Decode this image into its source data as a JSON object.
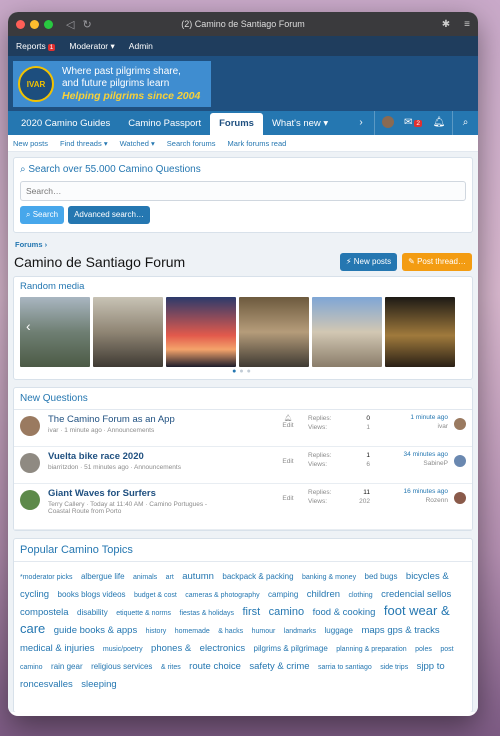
{
  "window": {
    "title": "(2) Camino de Santiago Forum"
  },
  "staffbar": {
    "reports": "Reports",
    "reports_count": "1",
    "moderator": "Moderator",
    "admin": "Admin"
  },
  "logo": {
    "mark": "IVAR",
    "line1": "Where past pilgrims share,",
    "line2": "and future pilgrims learn",
    "line3": "Helping pilgrims since 2004"
  },
  "nav": {
    "tabs": [
      "2020 Camino Guides",
      "Camino Passport",
      "Forums",
      "What's new"
    ],
    "active_index": 2,
    "inbox_count": "2"
  },
  "subnav": [
    "New posts",
    "Find threads",
    "Watched",
    "Search forums",
    "Mark forums read"
  ],
  "search": {
    "title": "Search over 55.000 Camino Questions",
    "placeholder": "Search…",
    "search_button": "Search",
    "advanced_button": "Advanced search…"
  },
  "breadcrumb": "Forums",
  "page_title": "Camino de Santiago Forum",
  "buttons": {
    "new_posts": "New posts",
    "post_thread": "Post thread…"
  },
  "random_media": {
    "title": "Random media"
  },
  "new_questions": {
    "title": "New Questions",
    "threads": [
      {
        "title": "The Camino Forum as an App",
        "meta": "ivar · 1 minute ago · Announcements",
        "meta2": "",
        "replies": "0",
        "views": "1",
        "last_time": "1 minute ago",
        "last_user": "ivar",
        "bold": false,
        "watch": true
      },
      {
        "title": "Vuelta bike race 2020",
        "meta": "biarritzdon · 51 minutes ago · Announcements",
        "meta2": "",
        "replies": "1",
        "views": "6",
        "last_time": "34 minutes ago",
        "last_user": "SabineP",
        "bold": true,
        "watch": false
      },
      {
        "title": "Giant Waves for Surfers",
        "meta": "Terry Callery · Today at 11:40 AM · Camino Portugues -",
        "meta2": "Coastal Route from Porto",
        "replies": "11",
        "views": "202",
        "last_time": "16 minutes ago",
        "last_user": "Rozenn",
        "bold": true,
        "watch": false
      }
    ],
    "labels": {
      "replies": "Replies:",
      "views": "Views:",
      "edit": "Edit"
    }
  },
  "popular": {
    "title": "Popular Camino Topics",
    "tags": [
      [
        "*moderator picks",
        1
      ],
      [
        "albergue life",
        2
      ],
      [
        "animals",
        1
      ],
      [
        "art",
        1
      ],
      [
        "autumn",
        3
      ],
      [
        "backpack & packing",
        2
      ],
      [
        "banking & money",
        1
      ],
      [
        "bed bugs",
        2
      ],
      [
        "bicycles & cycling",
        3
      ],
      [
        "books blogs videos",
        2
      ],
      [
        "budget & cost",
        1
      ],
      [
        "cameras & photography",
        1
      ],
      [
        "camping",
        2
      ],
      [
        "children",
        3
      ],
      [
        "clothing",
        1
      ],
      [
        "credencial sellos compostela",
        3
      ],
      [
        "disability",
        2
      ],
      [
        "etiquette & norms",
        1
      ],
      [
        "fiestas & holidays",
        1
      ],
      [
        "first",
        4
      ],
      [
        "camino",
        4
      ],
      [
        "food & cooking",
        3
      ],
      [
        "foot wear & care",
        5
      ],
      [
        "guide books & apps",
        3
      ],
      [
        "history",
        1
      ],
      [
        "homemade",
        1
      ],
      [
        "& hacks",
        1
      ],
      [
        "humour",
        1
      ],
      [
        "landmarks",
        1
      ],
      [
        "luggage",
        2
      ],
      [
        "maps gps & tracks",
        3
      ],
      [
        "medical & injuries",
        3
      ],
      [
        "music/poetry",
        1
      ],
      [
        "phones &",
        3
      ],
      [
        "electronics",
        3
      ],
      [
        "pilgrims & pilgrimage",
        2
      ],
      [
        "planning & preparation",
        1
      ],
      [
        "poles",
        1
      ],
      [
        "post camino",
        1
      ],
      [
        "rain gear",
        2
      ],
      [
        "religious services",
        2
      ],
      [
        "& rites",
        1
      ],
      [
        "route choice",
        3
      ],
      [
        "safety & crime",
        3
      ],
      [
        "sarria to santiago",
        1
      ],
      [
        "side trips",
        1
      ],
      [
        "sjpp to roncesvalles",
        3
      ],
      [
        "sleeping",
        3
      ]
    ]
  },
  "colors": {
    "accent": "#2577b1",
    "header": "#1f5080",
    "orange": "#f39c12"
  }
}
